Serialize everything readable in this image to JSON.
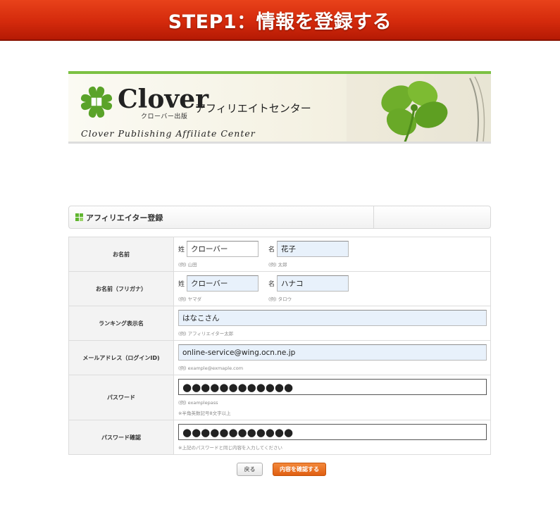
{
  "step_banner": {
    "title": "STEP1：情報を登録する"
  },
  "header": {
    "logo_word": "Clover",
    "logo_sub": "クローバー出版",
    "tagline": "アフィリエイトセンター",
    "english": "Clover Publishing Affiliate Center",
    "accent": "#7cc143"
  },
  "section": {
    "title": "アフィリエイター登録",
    "icon": "green-squares-icon"
  },
  "form": {
    "name": {
      "label": "お名前",
      "last_prefix": "姓",
      "last_value": "クローバー",
      "last_hint": "(例) 山田",
      "first_prefix": "名",
      "first_value": "花子",
      "first_hint": "(例) 太郎"
    },
    "kana": {
      "label": "お名前（フリガナ）",
      "last_prefix": "姓",
      "last_value": "クローバー",
      "last_hint": "(例) ヤマダ",
      "first_prefix": "名",
      "first_value": "ハナコ",
      "first_hint": "(例) タロウ"
    },
    "ranking": {
      "label": "ランキング表示名",
      "value": "はなこさん",
      "hint": "(例) アフィリエイター太郎"
    },
    "email": {
      "label": "メールアドレス（ログインID)",
      "value": "online-service@wing.ocn.ne.jp",
      "hint": "(例) example@exmaple.com"
    },
    "password": {
      "label": "パスワード",
      "value": "●●●●●●●●●●●●",
      "hint": "(例) examplepass",
      "note": "※半角英数記号8文字以上"
    },
    "password_confirm": {
      "label": "パスワード確認",
      "value": "●●●●●●●●●●●●",
      "note": "※上記のパスワードと同じ内容を入力してください"
    }
  },
  "buttons": {
    "back": "戻る",
    "confirm": "内容を確認する"
  },
  "colors": {
    "banner_red": "#d42a0c",
    "confirm_orange": "#e05f12",
    "field_blue": "#e8f1fb"
  }
}
